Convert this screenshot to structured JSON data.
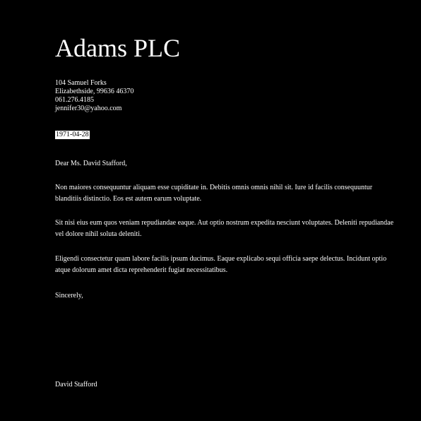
{
  "letter": {
    "company": "Adams PLC",
    "address": {
      "street": "104 Samuel Forks",
      "city_line": "Elizabethside, 99636 46370",
      "phone": "061.276.4185",
      "email": "jennifer30@yahoo.com"
    },
    "date": "1971-04-28",
    "salutation": "Dear Ms. David Stafford,",
    "paragraphs": [
      "Non maiores consequuntur aliquam esse cupiditate in. Debitis omnis omnis nihil sit. Iure id facilis consequuntur blanditiis distinctio. Eos est autem earum voluptate.",
      "Sit nisi eius eum quos veniam repudiandae eaque. Aut optio nostrum expedita nesciunt voluptates. Deleniti repudiandae vel dolore nihil soluta deleniti.",
      "Eligendi consectetur quam labore facilis ipsum ducimus. Eaque explicabo sequi officia saepe delectus. Incidunt optio atque dolorum amet dicta reprehenderit fugiat necessitatibus."
    ],
    "closing": "Sincerely,",
    "signature": "David Stafford"
  }
}
